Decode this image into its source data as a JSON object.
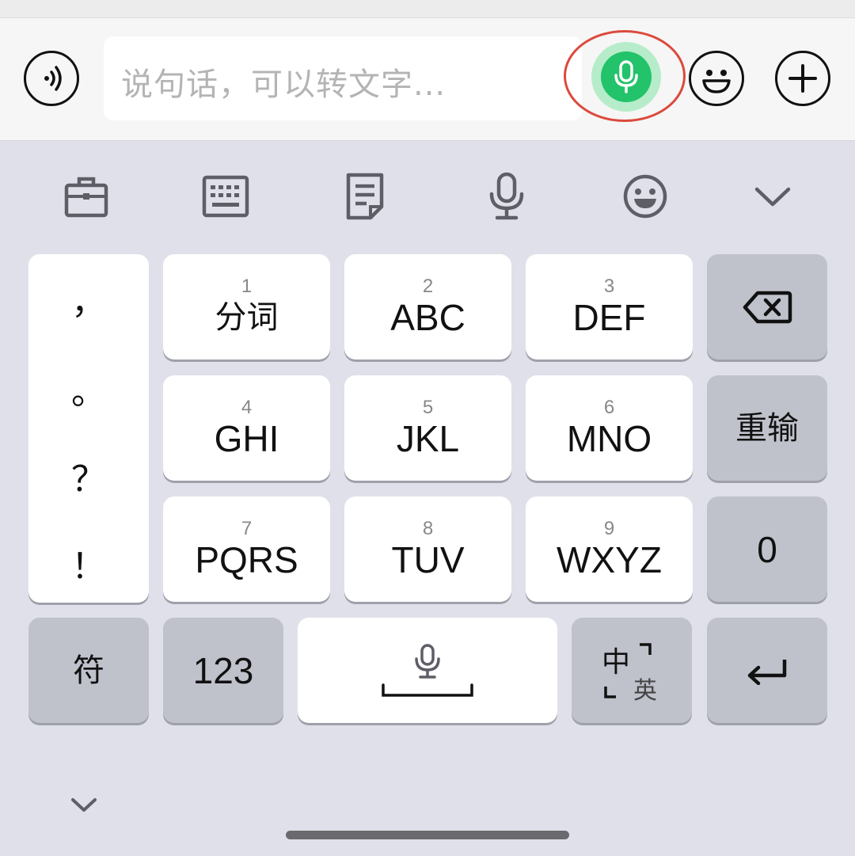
{
  "input_bar": {
    "placeholder": "说句话，可以转文字...",
    "voice_toggle_icon": "sound-wave-icon",
    "mic_icon": "microphone-icon",
    "emoji_icon": "smiley-icon",
    "plus_icon": "plus-icon",
    "mic_color": "#22c36a",
    "highlight_color": "#dc4a3c"
  },
  "toolbar": {
    "items": [
      {
        "icon": "toolbox-icon"
      },
      {
        "icon": "keyboard-icon"
      },
      {
        "icon": "document-icon"
      },
      {
        "icon": "microphone-icon"
      },
      {
        "icon": "smiley-icon"
      },
      {
        "icon": "chevron-down-icon"
      }
    ]
  },
  "keyboard": {
    "punctuation": [
      "，",
      "。",
      "？",
      "！"
    ],
    "keys": [
      {
        "num": "1",
        "label": "分词"
      },
      {
        "num": "2",
        "label": "ABC"
      },
      {
        "num": "3",
        "label": "DEF"
      },
      {
        "num": "4",
        "label": "GHI"
      },
      {
        "num": "5",
        "label": "JKL"
      },
      {
        "num": "6",
        "label": "MNO"
      },
      {
        "num": "7",
        "label": "PQRS"
      },
      {
        "num": "8",
        "label": "TUV"
      },
      {
        "num": "9",
        "label": "WXYZ"
      }
    ],
    "backspace_icon": "backspace-icon",
    "retype_label": "重输",
    "zero_label": "0",
    "symbol_label": "符",
    "numeric_label": "123",
    "space_icon": "microphone-icon",
    "lang_main": "中",
    "lang_sub": "英",
    "enter_icon": "return-icon"
  },
  "bottom": {
    "hide_icon": "chevron-down-icon"
  }
}
